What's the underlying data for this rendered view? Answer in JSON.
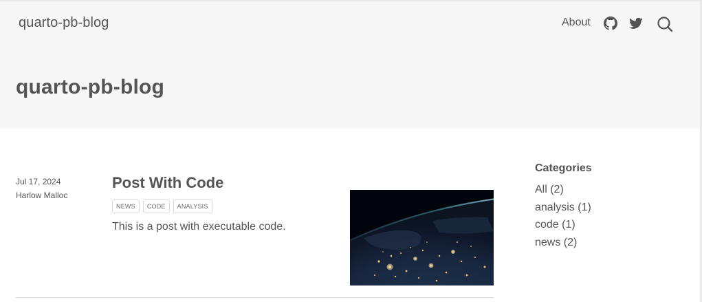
{
  "navbar": {
    "brand": "quarto-pb-blog",
    "about_label": "About",
    "icons": [
      "github-icon",
      "twitter-icon",
      "search-icon"
    ]
  },
  "header": {
    "title": "quarto-pb-blog"
  },
  "posts": [
    {
      "date": "Jul 17, 2024",
      "author": "Harlow Malloc",
      "title": "Post With Code",
      "categories": [
        "NEWS",
        "CODE",
        "ANALYSIS"
      ],
      "description": "This is a post with executable code."
    }
  ],
  "sidebar": {
    "heading": "Categories",
    "items": [
      "All (2)",
      "analysis (1)",
      "code (1)",
      "news (2)"
    ]
  },
  "colors": {
    "text": "#545454",
    "header_bg": "#f7f7f7",
    "border": "#d9d9d9"
  }
}
